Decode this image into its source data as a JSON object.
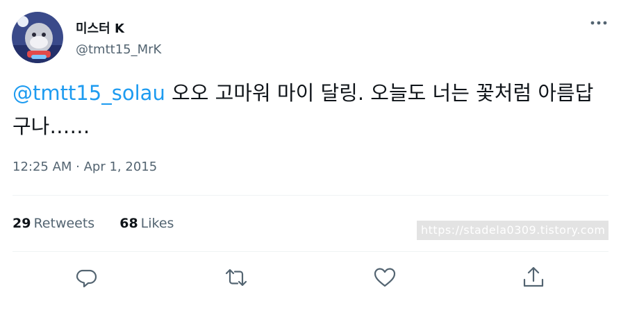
{
  "author": {
    "display_name": "미스터 K",
    "handle": "@tmtt15_MrK"
  },
  "tweet": {
    "mention": "@tmtt15_solau",
    "text": " 오오 고마워 마이 달링. 오늘도 너는 꽃처럼 아름답구나……",
    "timestamp": "12:25 AM · Apr 1, 2015"
  },
  "stats": {
    "retweets_count": "29",
    "retweets_label": "Retweets",
    "likes_count": "68",
    "likes_label": "Likes"
  },
  "watermark": "https://stadela0309.tistory.com",
  "icons": {
    "more": "more-horizontal-icon",
    "reply": "reply-icon",
    "retweet": "retweet-icon",
    "like": "heart-icon",
    "share": "share-icon"
  },
  "colors": {
    "accent": "#1d9bf0",
    "secondary_text": "#536471",
    "primary_text": "#0f1419"
  }
}
